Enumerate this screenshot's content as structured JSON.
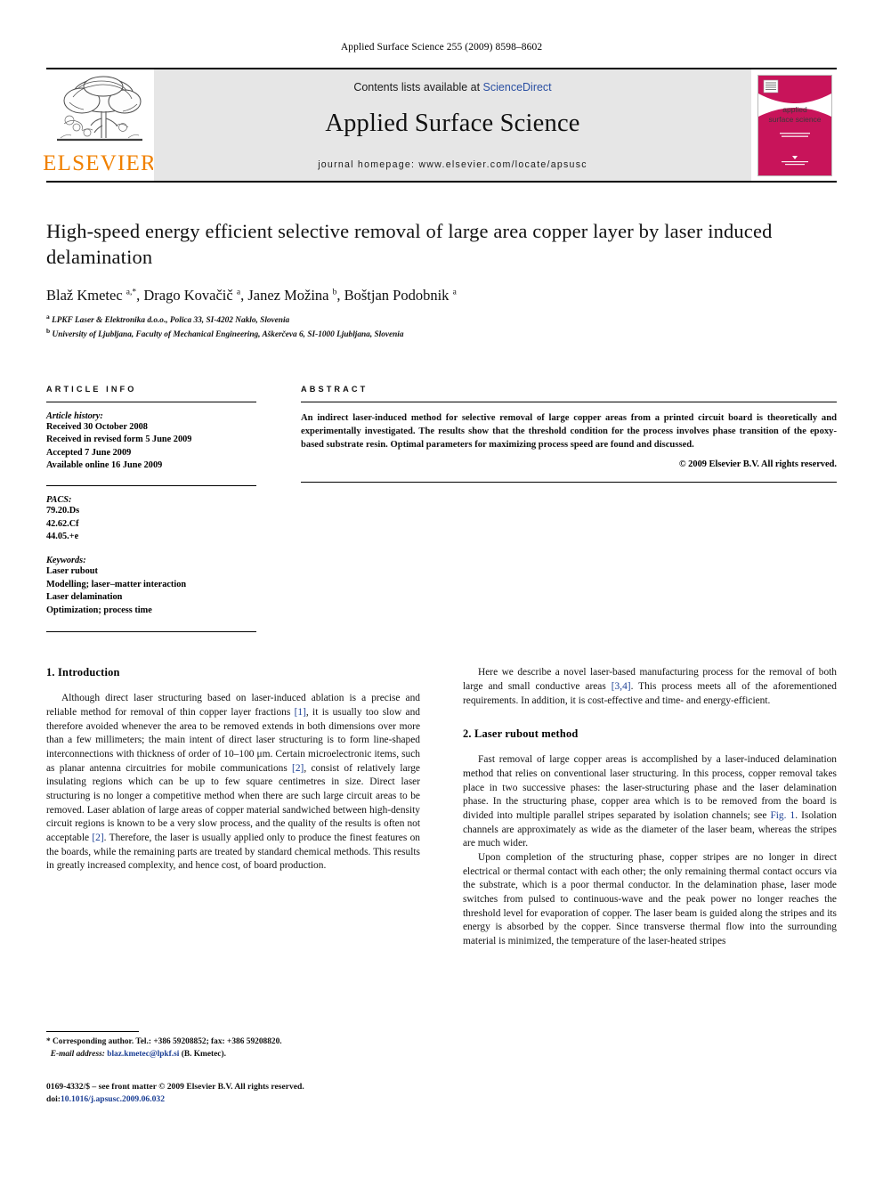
{
  "running_head": "Applied Surface Science 255 (2009) 8598–8602",
  "masthead": {
    "contents_prefix": "Contents lists available at ",
    "sciencedirect": "ScienceDirect",
    "journal_title": "Applied Surface Science",
    "homepage": "journal homepage: www.elsevier.com/locate/apsusc",
    "publisher_name": "ELSEVIER",
    "cover": {
      "line1": "applied",
      "line2": "surface science",
      "accent_color": "#C8145A"
    }
  },
  "article": {
    "title": "High-speed energy efficient selective removal of large area copper layer by laser induced delamination",
    "authors_html": "Blaž Kmetec <sup>a,*</sup>, Drago Kovačič <sup>a</sup>, Janez Možina <sup>b</sup>, Boštjan Podobnik <sup>a</sup>",
    "affiliation_a": "LPKF Laser & Elektronika d.o.o., Polica 33, SI-4202 Naklo, Slovenia",
    "affiliation_b": "University of Ljubljana, Faculty of Mechanical Engineering, Aškerčeva 6, SI-1000 Ljubljana, Slovenia"
  },
  "info": {
    "label": "ARTICLE INFO",
    "history_head": "Article history:",
    "history": [
      "Received 30 October 2008",
      "Received in revised form 5 June 2009",
      "Accepted 7 June 2009",
      "Available online 16 June 2009"
    ],
    "pacs_head": "PACS:",
    "pacs": [
      "79.20.Ds",
      "42.62.Cf",
      "44.05.+e"
    ],
    "keywords_head": "Keywords:",
    "keywords": [
      "Laser rubout",
      "Modelling; laser–matter interaction",
      "Laser delamination",
      "Optimization; process time"
    ]
  },
  "abstract": {
    "label": "ABSTRACT",
    "text": "An indirect laser-induced method for selective removal of large copper areas from a printed circuit board is theoretically and experimentally investigated. The results show that the threshold condition for the process involves phase transition of the epoxy-based substrate resin. Optimal parameters for maximizing process speed are found and discussed.",
    "copyright": "© 2009 Elsevier B.V. All rights reserved."
  },
  "body": {
    "section1_heading": "1. Introduction",
    "section1_para1_a": "Although direct laser structuring based on laser-induced ablation is a precise and reliable method for removal of thin copper layer fractions ",
    "section1_para1_ref1": "[1]",
    "section1_para1_b": ", it is usually too slow and therefore avoided whenever the area to be removed extends in both dimensions over more than a few millimeters; the main intent of direct laser structuring is to form line-shaped interconnections with thickness of order of 10–100 μm. Certain microelectronic items, such as planar antenna circuitries for mobile communications ",
    "section1_para1_ref2": "[2]",
    "section1_para1_c": ", consist of relatively large insulating regions which can be up to few square centimetres in size. Direct laser structuring is no longer a competitive method when there are such large circuit areas to be removed. Laser ablation of large areas of copper material sandwiched between high-density circuit regions is known to be a very slow process, and the quality of the results is often not acceptable ",
    "section1_para1_ref3": "[2]",
    "section1_para1_d": ". Therefore, the laser is usually applied only to produce the finest features on the boards, while the remaining parts are treated by standard chemical methods. This results in greatly increased complexity, and hence cost, of board production.",
    "rcol_para1_a": "Here we describe a novel laser-based manufacturing process for the removal of both large and small conductive areas ",
    "rcol_para1_ref": "[3,4]",
    "rcol_para1_b": ". This process meets all of the aforementioned requirements. In addition, it is cost-effective and time- and energy-efficient.",
    "section2_heading": "2. Laser rubout method",
    "section2_para1_a": "Fast removal of large copper areas is accomplished by a laser-induced delamination method that relies on conventional laser structuring. In this process, copper removal takes place in two successive phases: the laser-structuring phase and the laser delamination phase. In the structuring phase, copper area which is to be removed from the board is divided into multiple parallel stripes separated by isolation channels; see ",
    "section2_para1_figref": "Fig. 1",
    "section2_para1_b": ". Isolation channels are approximately as wide as the diameter of the laser beam, whereas the stripes are much wider.",
    "section2_para2": "Upon completion of the structuring phase, copper stripes are no longer in direct electrical or thermal contact with each other; the only remaining thermal contact occurs via the substrate, which is a poor thermal conductor. In the delamination phase, laser mode switches from pulsed to continuous-wave and the peak power no longer reaches the threshold level for evaporation of copper. The laser beam is guided along the stripes and its energy is absorbed by the copper. Since transverse thermal flow into the surrounding material is minimized, the temperature of the laser-heated stripes"
  },
  "footnotes": {
    "corresponding_marker": "*",
    "corresponding": "Corresponding author. Tel.: +386 59208852; fax: +386 59208820.",
    "email_label": "E-mail address:",
    "email": "blaz.kmetec@lpkf.si",
    "email_suffix": "(B. Kmetec).",
    "imprint_line1": "0169-4332/$ – see front matter © 2009 Elsevier B.V. All rights reserved.",
    "imprint_doi_label": "doi:",
    "imprint_doi": "10.1016/j.apsusc.2009.06.032"
  }
}
